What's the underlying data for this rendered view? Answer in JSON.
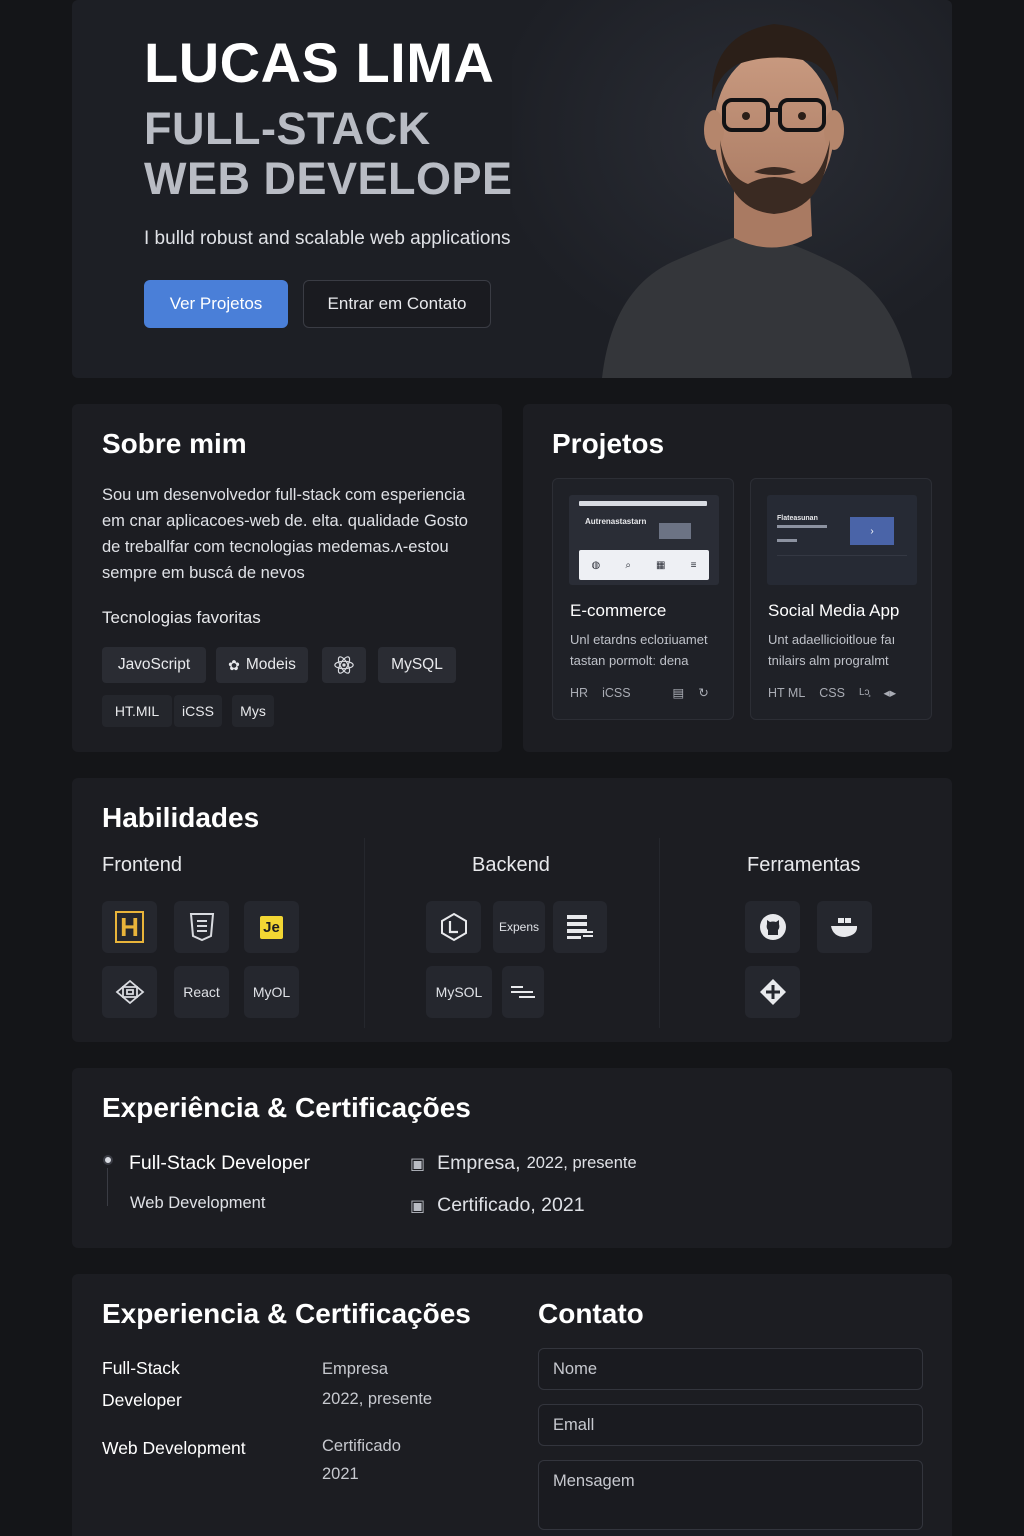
{
  "hero": {
    "name": "LUCAS LIMA",
    "role_line1": "FULL-STACK",
    "role_line2": "WEB DEVELOPER",
    "tagline": "I bulld robust and scalable web applications.",
    "primary_button": "Ver Projetos",
    "secondary_button": "Entrar em Contato"
  },
  "about": {
    "title": "Sobre mim",
    "text": "Sou um desenvolvedor full-stack com esperiencia em cnar aplicacoes-web de. elta. qualidade  Gosto de treballfar com tecnologias medemas.ʌ-estou sempre em buscá de nevos",
    "subtitle": "Tecnologias favoritas",
    "chips": [
      "JavoScript",
      "Modeis",
      "",
      "MySQL"
    ],
    "chips_small": [
      "HT.MIL",
      "iCSS",
      "Mys"
    ]
  },
  "projects": {
    "title": "Projetos",
    "items": [
      {
        "thumb_title": "Autrenastastarn",
        "title": "E-commerce",
        "desc_line1": "Unl etardns ecloɪiuamet",
        "desc_line2": "tastan pormoltː dena",
        "tags": [
          "HR",
          "iCSS"
        ]
      },
      {
        "thumb_title": "Flateasunan",
        "title": "Social Media App",
        "desc_line1": "Unt adaellicioitloue faı",
        "desc_line2": "tnilairs alm progralmt",
        "tags": [
          "HT ML",
          "CSS",
          "Lɔ̧"
        ]
      }
    ]
  },
  "skills": {
    "title": "Habilidades",
    "frontend": {
      "title": "Frontend",
      "tiles": [
        "H",
        "",
        "Je",
        "",
        "React",
        "MyOL"
      ]
    },
    "backend": {
      "title": "Backend",
      "tiles": [
        "",
        "Expens",
        "",
        "MySOL",
        ""
      ]
    },
    "tools": {
      "title": "Ferramentas"
    },
    "colors": {
      "html_gold": "#e9b43a",
      "js_yellow": "#f2d633"
    }
  },
  "experience1": {
    "title": "Experiência & Certificações",
    "role": "Full-Stack Developer",
    "sub": "Web Development",
    "line1_main": "Empresa,",
    "line1_small": "2022, presente",
    "line2": "Certificado, 2021"
  },
  "experience2": {
    "title": "Experiencia & Certificações",
    "role_line1": "Full-Stack",
    "role_line2": "Developer",
    "company": "Empresa",
    "period": "2022, presente",
    "sub": "Web Development",
    "cert_line1": "Certificado",
    "cert_line2": "2021"
  },
  "contact": {
    "title": "Contato",
    "name_placeholder": "Nome",
    "email_placeholder": "Emall",
    "message_placeholder": "Mensagem"
  },
  "theme": {
    "accent": "#4a7fd8",
    "background": "#141518",
    "card": "#1c1d22"
  }
}
